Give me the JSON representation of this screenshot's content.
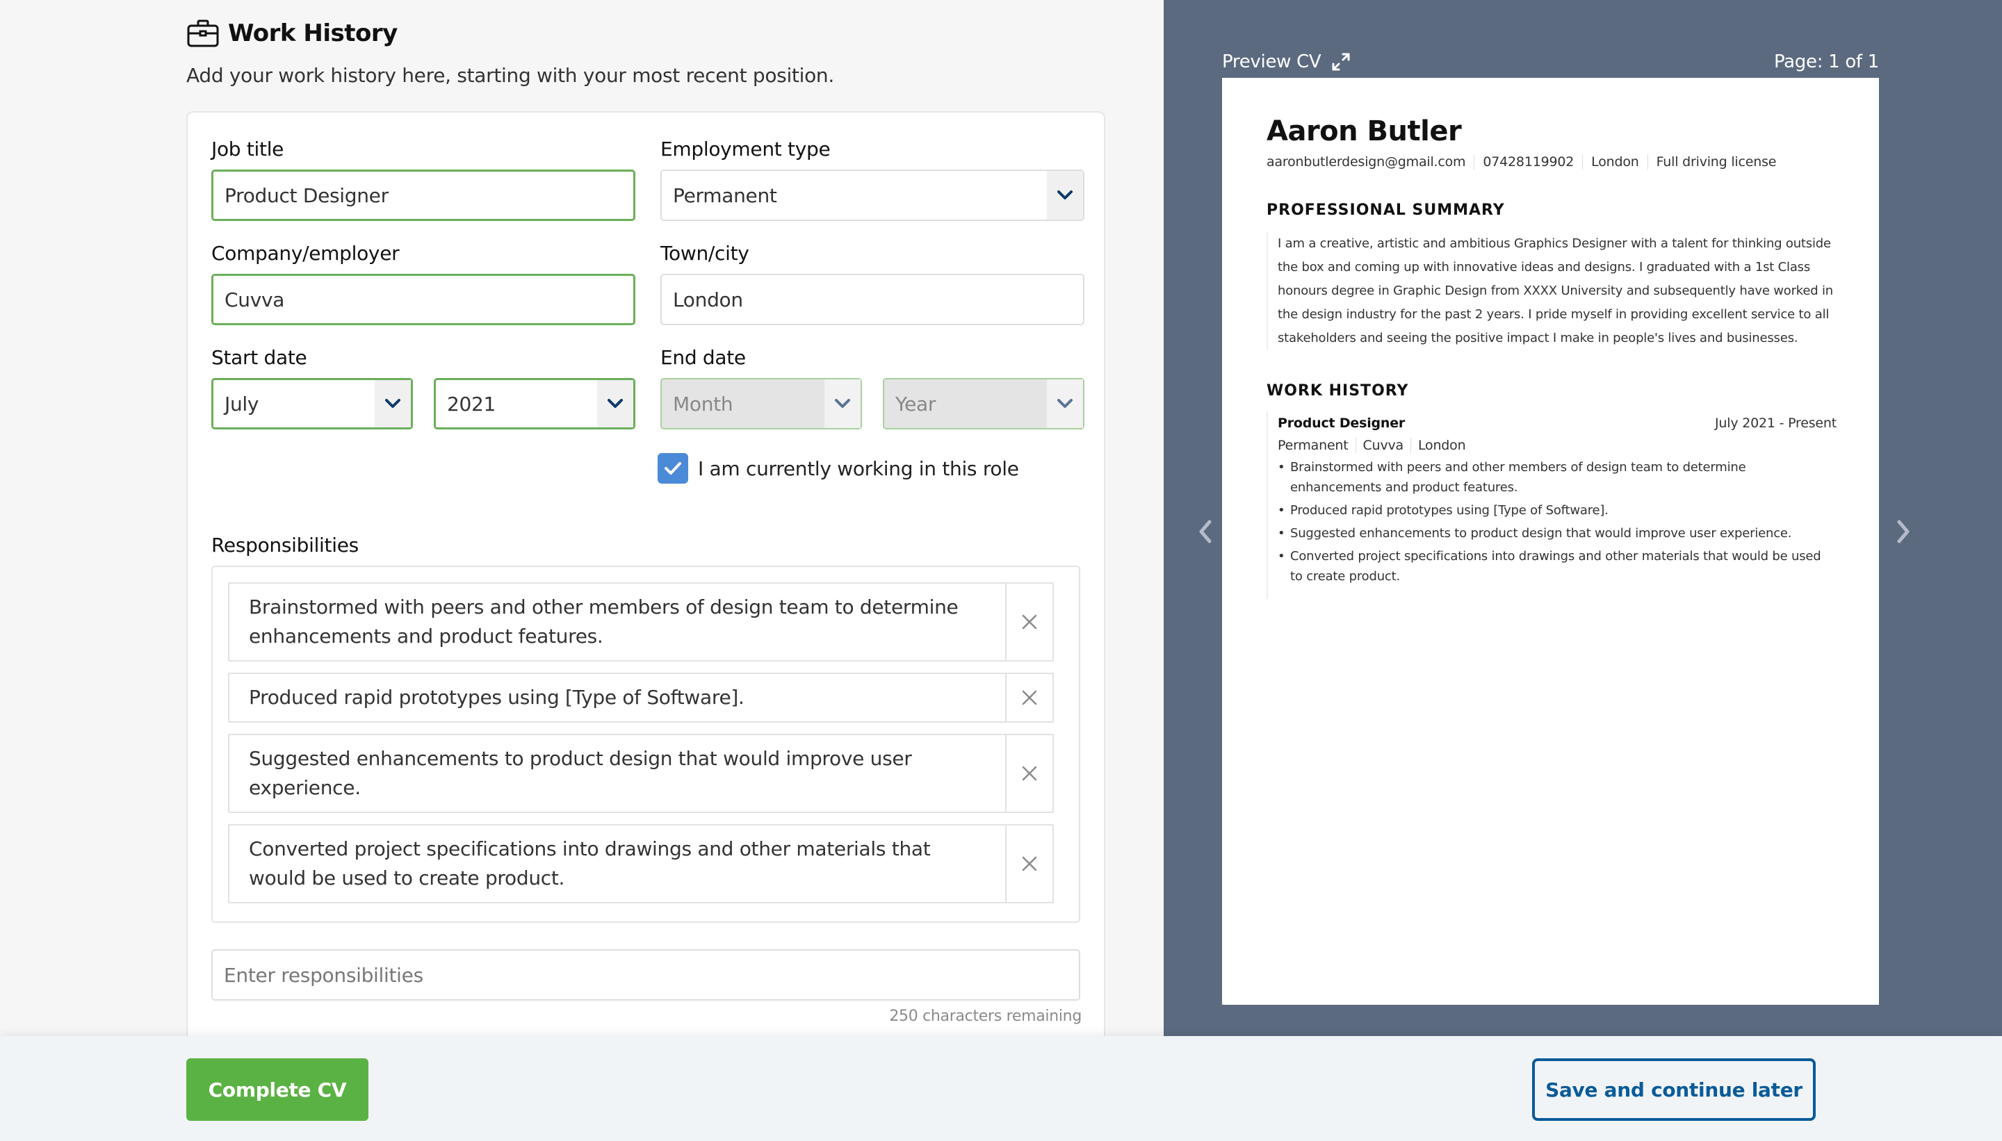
{
  "form": {
    "title": "Work History",
    "title_icon": "briefcase-icon",
    "intro": "Add your work history here, starting with your most recent position.",
    "job_title": {
      "label": "Job title",
      "value": "Product Designer"
    },
    "employment_type": {
      "label": "Employment type",
      "value": "Permanent"
    },
    "company": {
      "label": "Company/employer",
      "value": "Cuvva"
    },
    "town": {
      "label": "Town/city",
      "value": "London"
    },
    "start_date": {
      "label": "Start date",
      "month": "July",
      "year": "2021"
    },
    "end_date": {
      "label": "End date",
      "month_placeholder": "Month",
      "year_placeholder": "Year"
    },
    "current_role": {
      "label": "I am currently working in this role",
      "checked": true
    },
    "responsibilities": {
      "label": "Responsibilities",
      "items": [
        "Brainstormed with peers and other members of design team to determine enhancements and product features.",
        "Produced rapid prototypes using [Type of Software].",
        "Suggested enhancements to product design that would improve user experience.",
        "Converted project specifications into drawings and other materials that would be used to create product."
      ],
      "input_placeholder": "Enter responsibilities",
      "chars_remaining": "250 characters remaining"
    }
  },
  "preview": {
    "label": "Preview CV",
    "expand_icon": "expand-icon",
    "page_indicator": "Page: 1 of 1",
    "cv": {
      "name": "Aaron Butler",
      "contact": [
        "aaronbutlerdesign@gmail.com",
        "07428119902",
        "London",
        "Full driving license"
      ],
      "summary_title": "PROFESSIONAL SUMMARY",
      "summary": "I am a creative, artistic and ambitious Graphics Designer with a talent for thinking outside the box and coming up with innovative ideas and designs. I graduated with a 1st Class honours degree in Graphic Design from XXXX University and subsequently have worked in the design industry for the past 2 years. I pride myself in providing excellent service to all stakeholders and seeing the positive impact I make in people's lives and businesses.",
      "work_title": "WORK HISTORY",
      "job": {
        "title": "Product Designer",
        "dates": "July 2021 - Present",
        "meta": [
          "Permanent",
          "Cuvva",
          "London"
        ],
        "bullets": [
          "Brainstormed with peers and other members of design team to determine enhancements and product features.",
          "Produced rapid prototypes using [Type of Software].",
          "Suggested enhancements to product design that would improve user experience.",
          "Converted project specifications into drawings and other materials that would be used to create product."
        ]
      }
    }
  },
  "footer": {
    "complete_label": "Complete CV",
    "save_label": "Save and continue later"
  },
  "colors": {
    "accent_green": "#5bb244",
    "valid_border": "#6aaf5a",
    "checkbox_blue": "#4a8ad6",
    "save_blue": "#0a5b99",
    "preview_bg": "#5c6a80"
  }
}
